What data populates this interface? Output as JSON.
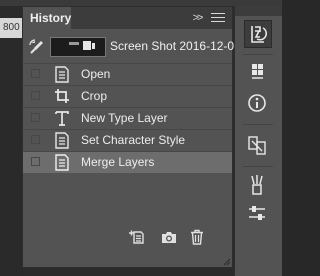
{
  "canvas": {
    "ruler_text": "800"
  },
  "panel": {
    "title": "History",
    "collapse_glyph": ">>",
    "snapshot_label": "Screen Shot 2016-12-0...",
    "items": [
      {
        "label": "Open",
        "icon": "document-icon",
        "active": false
      },
      {
        "label": "Crop",
        "icon": "crop-icon",
        "active": false
      },
      {
        "label": "New Type Layer",
        "icon": "type-tool-icon",
        "active": false
      },
      {
        "label": "Set Character Style",
        "icon": "document-icon",
        "active": false
      },
      {
        "label": "Merge Layers",
        "icon": "document-icon",
        "active": true
      }
    ],
    "footer_buttons": [
      {
        "name": "new-document-from-state-button",
        "icon": "new-document-icon"
      },
      {
        "name": "create-new-snapshot-button",
        "icon": "camera-icon"
      },
      {
        "name": "delete-state-button",
        "icon": "trash-icon"
      }
    ]
  },
  "dock": {
    "buttons": [
      {
        "name": "history-panel-button",
        "icon": "history-icon",
        "active": true
      },
      {
        "name": "properties-panel-button",
        "icon": "properties-icon",
        "active": false
      },
      {
        "name": "info-panel-button",
        "icon": "info-icon",
        "active": false
      },
      {
        "name": "clone-source-panel-button",
        "icon": "clone-source-icon",
        "active": false
      },
      {
        "name": "brush-presets-panel-button",
        "icon": "brushes-icon",
        "active": false
      },
      {
        "name": "adjustments-panel-button",
        "icon": "sliders-icon",
        "active": false
      }
    ]
  },
  "colors": {
    "panel_bg": "#535353",
    "active_row": "#6d6d6d",
    "tab_bar": "#3c3c3c",
    "text": "#f0f0f0"
  }
}
